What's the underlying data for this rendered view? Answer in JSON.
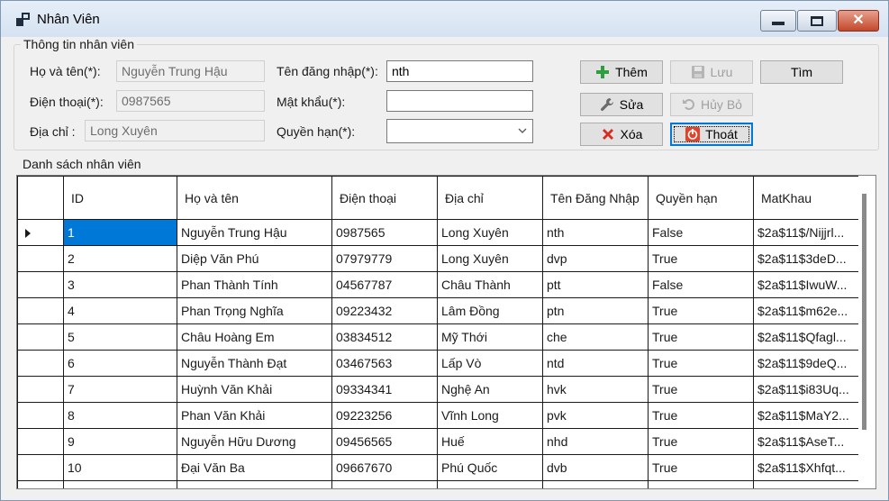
{
  "window": {
    "title": "Nhân Viên"
  },
  "info_group": {
    "title": "Thông tin nhân viên"
  },
  "form": {
    "fullname_label": "Họ và tên(*):",
    "fullname_value": "Nguyễn Trung Hậu",
    "phone_label": "Điện thoại(*):",
    "phone_value": "0987565",
    "address_label": "Địa chỉ :",
    "address_value": "Long Xuyên",
    "username_label": "Tên đăng nhập(*):",
    "username_value": "nth",
    "password_label": "Mật khẩu(*):",
    "password_value": "",
    "role_label": "Quyền hạn(*):",
    "role_value": ""
  },
  "buttons": {
    "add": "Thêm",
    "save": "Lưu",
    "search": "Tìm",
    "edit": "Sửa",
    "cancel": "Hủy Bỏ",
    "delete": "Xóa",
    "exit": "Thoát"
  },
  "list_section": {
    "title": "Danh sách nhân viên"
  },
  "table": {
    "columns": {
      "id": "ID",
      "fullname": "Họ và tên",
      "phone": "Điện thoại",
      "address": "Địa chỉ",
      "username": "Tên Đăng Nhập",
      "role": "Quyền hạn",
      "password": "MatKhau"
    },
    "rows": [
      [
        "1",
        "Nguyễn Trung Hậu",
        "0987565",
        "Long Xuyên",
        "nth",
        "False",
        "$2a$11$/Nijjrl..."
      ],
      [
        "2",
        "Diệp Văn Phú",
        "07979779",
        "Long Xuyên",
        "dvp",
        "True",
        "$2a$11$3deD..."
      ],
      [
        "3",
        "Phan Thành Tính",
        "04567787",
        "Châu Thành",
        "ptt",
        "False",
        "$2a$11$IwuW..."
      ],
      [
        "4",
        "Phan Trọng Nghĩa",
        "09223432",
        "Lâm Đồng",
        "ptn",
        "True",
        "$2a$11$m62e..."
      ],
      [
        "5",
        "Châu Hoàng Em",
        "03834512",
        "Mỹ Thới",
        "che",
        "True",
        "$2a$11$Qfagl..."
      ],
      [
        "6",
        "Nguyễn Thành Đạt",
        "03467563",
        "Lấp Vò",
        "ntd",
        "True",
        "$2a$11$9deQ..."
      ],
      [
        "7",
        "Huỳnh Văn Khải",
        "09334341",
        "Nghệ An",
        "hvk",
        "True",
        "$2a$11$i83Uq..."
      ],
      [
        "8",
        "Phan Văn Khải",
        "09223256",
        "Vĩnh Long",
        "pvk",
        "True",
        "$2a$11$MaY2..."
      ],
      [
        "9",
        "Nguyễn Hữu Dương",
        "09456565",
        "Huế",
        "nhd",
        "True",
        "$2a$11$AseT..."
      ],
      [
        "10",
        "Đại Văn Ba",
        "09667670",
        "Phú Quốc",
        "dvb",
        "True",
        "$2a$11$Xhfqt..."
      ]
    ],
    "selected_row": 0
  },
  "colors": {
    "selection": "#0078d7",
    "add_icon": "#2e9e3e",
    "delete_icon": "#d62d20",
    "exit_icon": "#e0432a"
  }
}
